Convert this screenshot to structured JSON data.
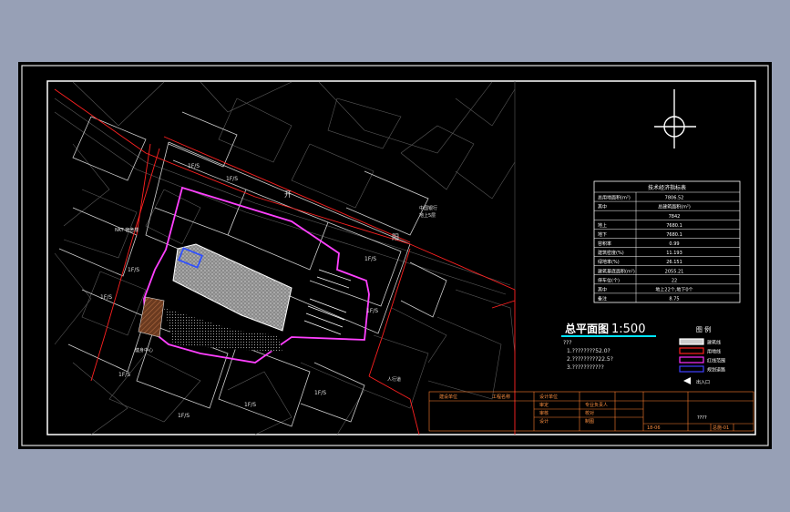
{
  "viewport": {
    "background": "#97a0b6",
    "paper": "#000000"
  },
  "plan_title": {
    "main": "总平面图",
    "scale": "1:500"
  },
  "north_arrow": {
    "name": "north-arrow"
  },
  "tech_table": {
    "title": "技术经济指标表",
    "rows": [
      {
        "label": "总用地面积(m²)",
        "value": "7806.52"
      },
      {
        "label": "其中",
        "value": "总建筑面积(m²)"
      },
      {
        "label": "",
        "value": "7842"
      },
      {
        "label": "地上",
        "value": "7680.1"
      },
      {
        "label": "地下",
        "value": "7680.1"
      },
      {
        "label": "容积率",
        "value": "0.99"
      },
      {
        "label": "建筑密度(%)",
        "value": "11.193"
      },
      {
        "label": "绿地率(%)",
        "value": "26.151"
      },
      {
        "label": "建筑基底面积(m²)",
        "value": "2055.21"
      },
      {
        "label": "停车位(个)",
        "value": "22"
      },
      {
        "label": "其中",
        "value": "地上22个,地下0个"
      },
      {
        "label": "备注",
        "value": "8.75"
      }
    ]
  },
  "notes": {
    "head": "???",
    "lines": [
      "1.????????52.0?",
      "2.?????????22.5?",
      "3.???????????"
    ]
  },
  "legend": {
    "title": "图  例",
    "items": [
      {
        "label": "建筑线",
        "color": "#ffffff",
        "fill": "#cccccc"
      },
      {
        "label": "用地线",
        "color": "#ff2020",
        "fill": "#000000"
      },
      {
        "label": "红线范围",
        "color": "#ff30ff",
        "fill": "#000000"
      },
      {
        "label": "规划道路",
        "color": "#4040ff",
        "fill": "#000000"
      }
    ],
    "arrow_label": "出入口"
  },
  "title_block": {
    "left_col": [
      "建设单位",
      "工程名称"
    ],
    "mid_col": [
      "设计单位",
      "审定",
      "审核",
      "设计"
    ],
    "right_col": [
      "专业负责人",
      "校对",
      "制图"
    ],
    "project": "????",
    "sheet_no": "总施-01",
    "date": "18-06"
  },
  "plan_labels": {
    "road_north": "开",
    "road_east": "阳",
    "building_labels": [
      "1F/S",
      "1F/S",
      "1F/S",
      "1F/S",
      "1F/S",
      "1F/S",
      "1F/S",
      "1F/S",
      "1F/S",
      "1F/S"
    ],
    "annot_1": "中国银行",
    "annot_2": "地上5层",
    "annot_3": "NKT 宿舍楼",
    "annot_4": "人行道",
    "annot_5": "健身中心"
  }
}
